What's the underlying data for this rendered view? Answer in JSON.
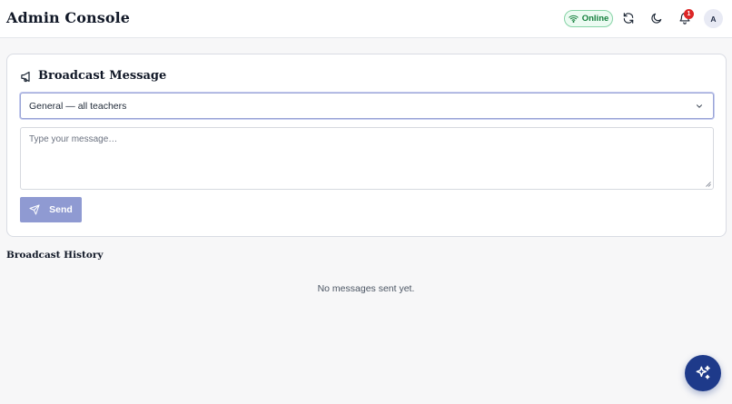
{
  "header": {
    "title": "Admin Console",
    "status": {
      "label": "Online",
      "icon": "wifi-icon",
      "color": "#15803d"
    },
    "refresh_icon": "refresh-icon",
    "theme_icon": "moon-icon",
    "notifications": {
      "icon": "bell-icon",
      "count": "1",
      "badge_color": "#dc2626"
    },
    "avatar_initial": "A"
  },
  "broadcast": {
    "title": "Broadcast Message",
    "title_icon": "megaphone-icon",
    "audience_selected": "General — all teachers",
    "message_placeholder": "Type your message…",
    "message_value": "",
    "send_label": "Send",
    "send_icon": "send-icon",
    "send_color": "#8f9ad2"
  },
  "history": {
    "title": "Broadcast History",
    "empty_text": "No messages sent yet."
  },
  "fab": {
    "icon": "sparkles-icon",
    "color": "#1e3a8a"
  }
}
